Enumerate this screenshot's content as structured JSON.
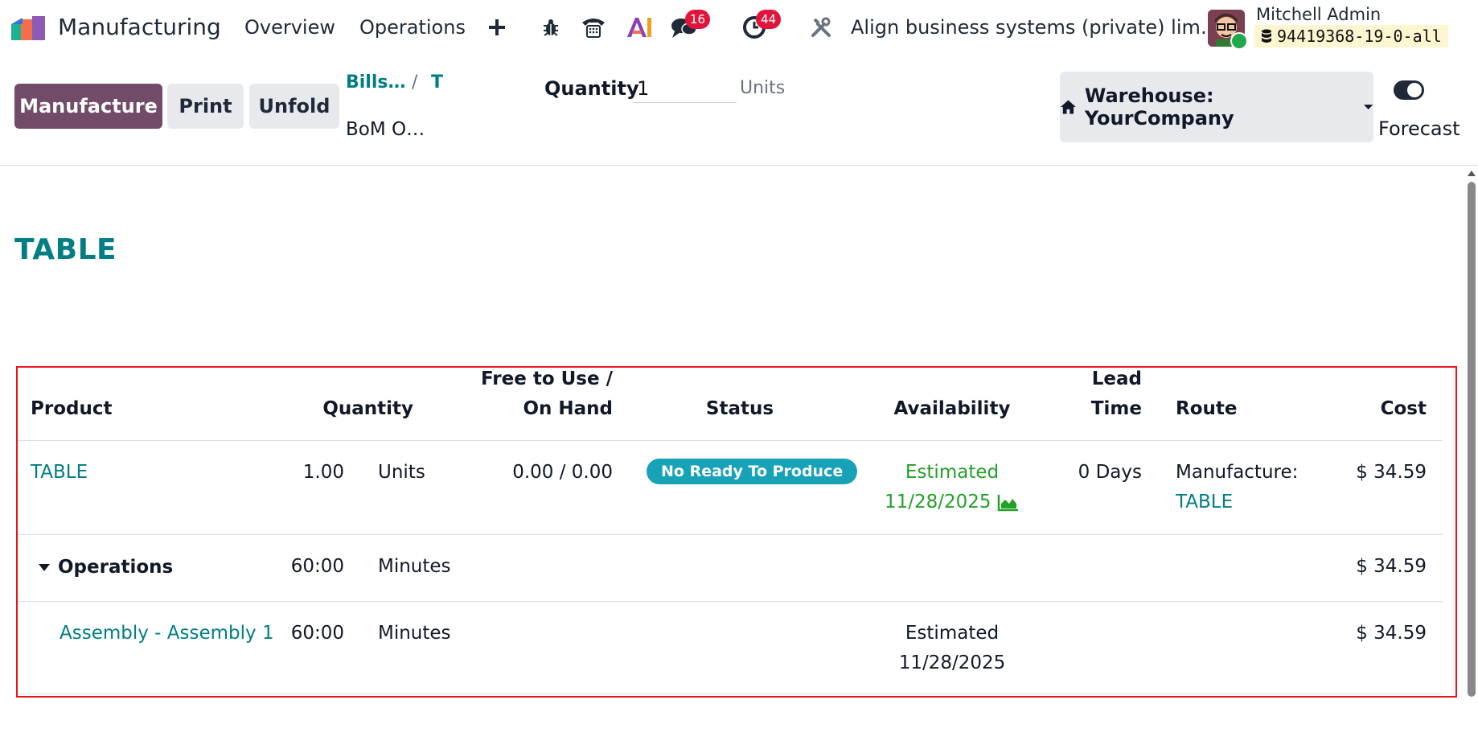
{
  "navbar": {
    "app_name": "Manufacturing",
    "menu": [
      "Overview",
      "Operations"
    ],
    "icons": [
      "add-icon",
      "bug-icon",
      "phone-icon",
      "ai-icon",
      "chat-icon",
      "clock-icon",
      "tools-icon"
    ],
    "messages_badge": "16",
    "activities_badge": "44",
    "company": "Align business systems (private) lim…",
    "user_name": "Mitchell Admin",
    "db_name": "94419368-19-0-all"
  },
  "control_panel": {
    "manufacture_label": "Manufacture",
    "print_label": "Print",
    "unfold_label": "Unfold",
    "breadcrumb": [
      "Bills…",
      "T"
    ],
    "breadcrumb_separator": "/",
    "breadcrumb_current": "BoM O…",
    "quantity_label": "Quantity",
    "quantity_value": "1",
    "quantity_unit": "Units",
    "warehouse_label": "Warehouse: YourCompany",
    "forecast_label": "Forecast"
  },
  "report": {
    "title": "TABLE",
    "headers": {
      "product": "Product",
      "quantity": "Quantity",
      "free_to_use_1": "Free to Use /",
      "free_to_use_2": "On Hand",
      "status": "Status",
      "availability": "Availability",
      "lead_time_1": "Lead",
      "lead_time_2": "Time",
      "route": "Route",
      "cost": "Cost"
    },
    "product_row": {
      "product": "TABLE",
      "quantity": "1.00",
      "uom": "Units",
      "free_on_hand": "0.00 / 0.00",
      "status": "No Ready To Produce",
      "availability_1": "Estimated",
      "availability_2": "11/28/2025",
      "lead_time": "0 Days",
      "route_1": "Manufacture:",
      "route_2": "TABLE",
      "cost": "$ 34.59"
    },
    "operations_row": {
      "label": "Operations",
      "quantity": "60:00",
      "uom": "Minutes",
      "cost": "$ 34.59"
    },
    "operation_line": {
      "label": "Assembly - Assembly 1",
      "quantity": "60:00",
      "uom": "Minutes",
      "availability_1": "Estimated",
      "availability_2": "11/28/2025",
      "cost": "$ 34.59"
    }
  },
  "colors": {
    "brand": "#714b67",
    "link": "#017e84",
    "available": "#23a12a",
    "status_badge": "#17a2b8",
    "notification_badge": "#e0143c",
    "highlight": "#e8121b"
  }
}
